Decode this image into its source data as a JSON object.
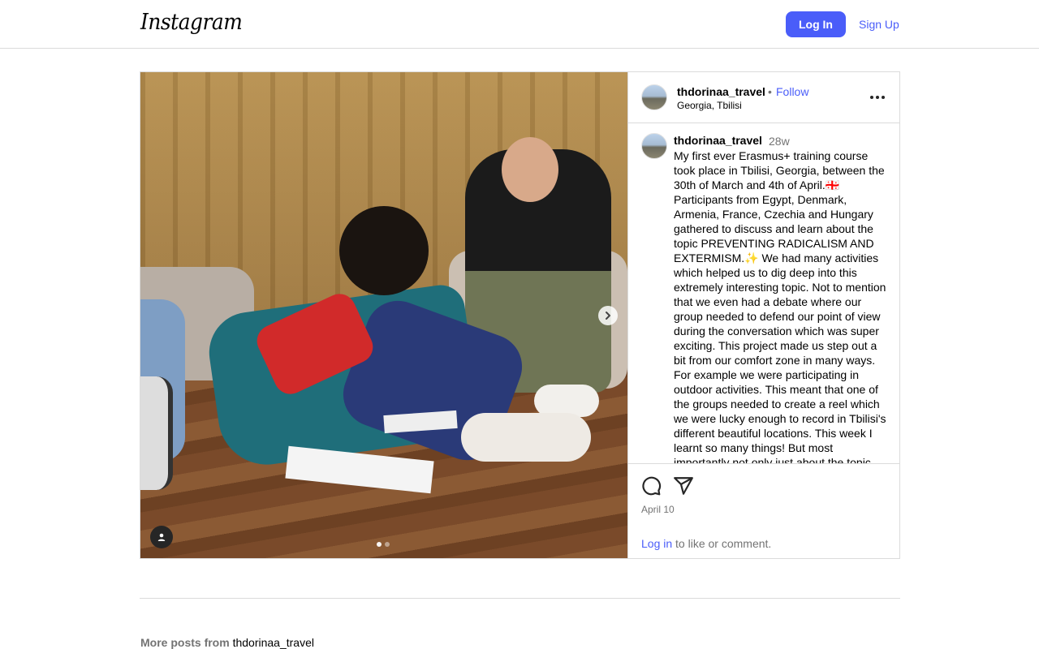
{
  "nav": {
    "logo_text": "Instagram",
    "login_label": "Log In",
    "signup_label": "Sign Up",
    "accent_color": "#4a5df9"
  },
  "post": {
    "username": "thdorinaa_travel",
    "separator": "•",
    "follow_label": "Follow",
    "location": "Georgia, Tbilisi",
    "caption_username": "thdorinaa_travel",
    "caption_time": "28w",
    "caption": "My first ever Erasmus+ training course took place in Tbilisi, Georgia, between the 30th of March and 4th of April.🇬🇪 Participants from Egypt, Denmark, Armenia, France, Czechia and Hungary gathered to discuss and learn about the topic PREVENTING RADICALISM AND EXTERMISM.✨ We had many activities which helped us to dig deep into this extremely interesting topic. Not to mention that we even had a debate where our group needed to defend our point of view during the conversation which was super exciting. This project made us step out a bit from our comfort zone in many ways. For example we were participating in outdoor activities. This meant that one of the groups needed to create a reel which we were lucky enough to record in Tbilisi's different beautiful locations. This week I learnt so many things! But most importantly not only just about the topic",
    "date": "April 10",
    "login_link": "Log in",
    "login_suffix": " to like or comment.",
    "carousel_count": 2,
    "carousel_active_index": 0,
    "icons": [
      "comment-icon",
      "share-icon",
      "more-options-icon",
      "chevron-right-icon",
      "tagged-user-icon"
    ]
  },
  "footer": {
    "more_posts_label": "More posts from ",
    "more_posts_user": "thdorinaa_travel"
  }
}
